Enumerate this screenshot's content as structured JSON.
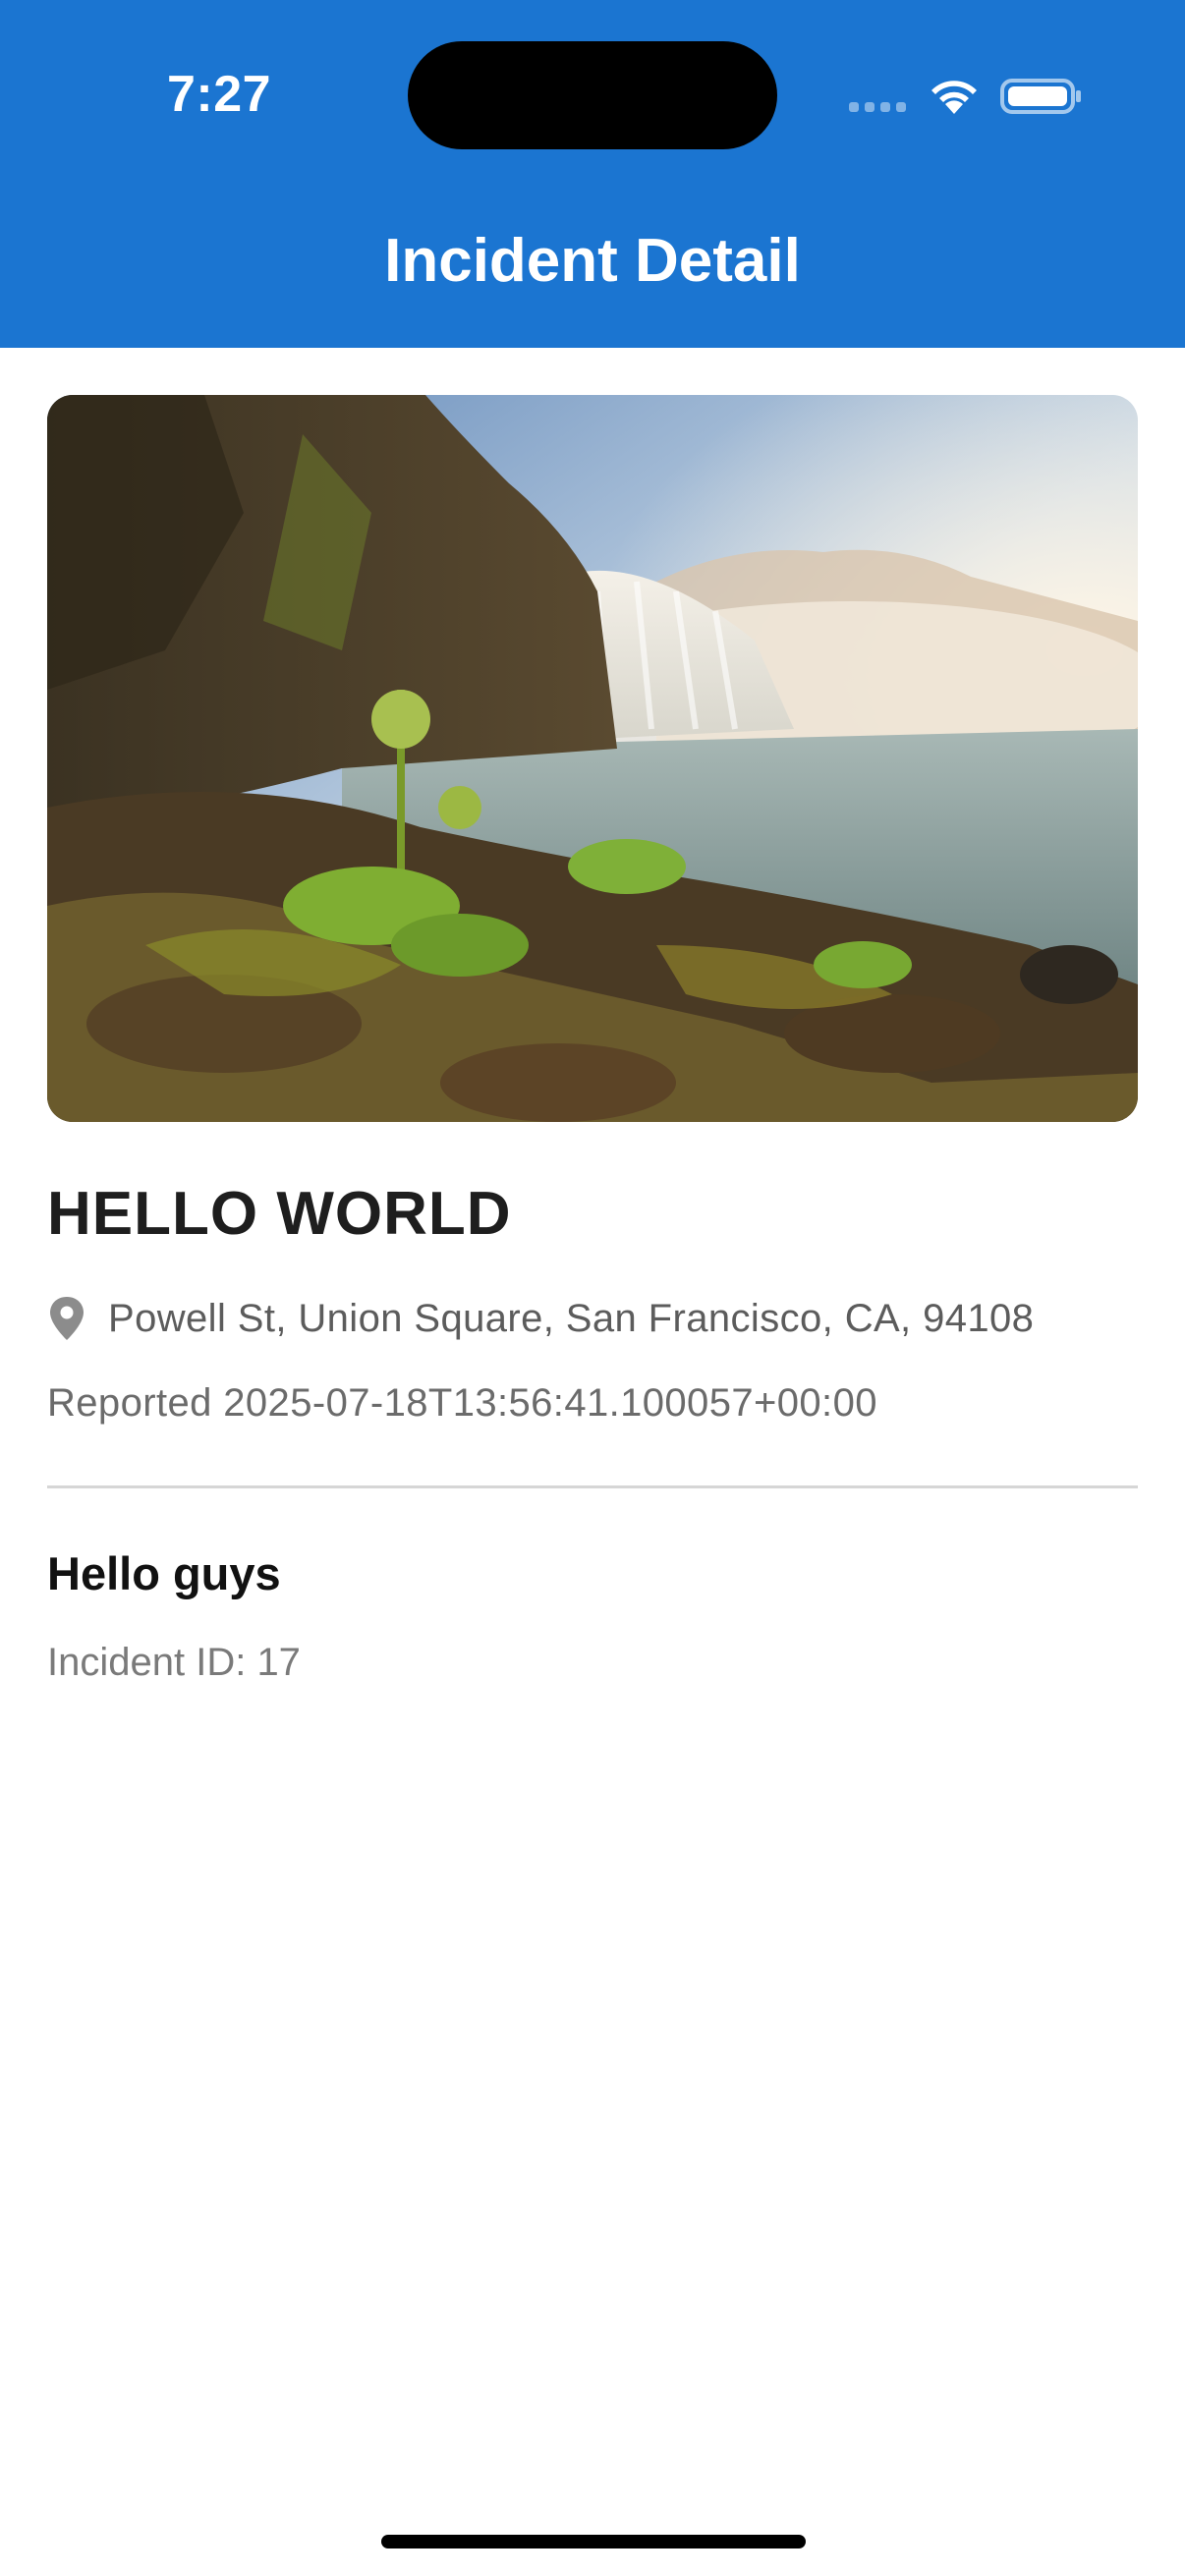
{
  "status_bar": {
    "time": "7:27"
  },
  "header": {
    "title": "Incident Detail"
  },
  "incident": {
    "image_subject": "waterfall landscape photo",
    "title": "HELLO WORLD",
    "location": "Powell St, Union Square, San Francisco, CA, 94108",
    "reported": "Reported 2025-07-18T13:56:41.100057+00:00",
    "description": "Hello guys",
    "id_label": "Incident ID: 17"
  },
  "icons": {
    "location": "location-pin-icon",
    "wifi": "wifi-icon",
    "battery": "battery-icon"
  },
  "colors": {
    "header_bg": "#1b75d1",
    "header_text": "#ffffff",
    "title_text": "#1e1e1e",
    "secondary_text": "#6b6b6b"
  }
}
